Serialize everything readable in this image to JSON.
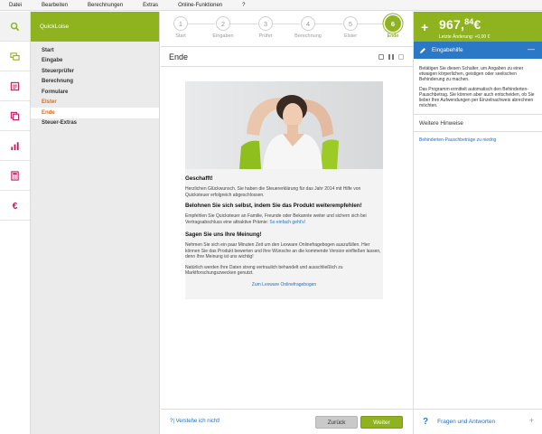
{
  "menu": [
    "Datei",
    "Bearbeiten",
    "Berechnungen",
    "Extras",
    "Online-Funktionen",
    "?"
  ],
  "sidebar_icons": [
    "search-icon",
    "chat-icon",
    "form-icon",
    "copy-icon",
    "bar-chart-icon",
    "calculator-icon",
    "euro-icon"
  ],
  "nav": {
    "title": "QuickLoise",
    "items": [
      {
        "label": "Start",
        "state": "normal"
      },
      {
        "label": "Eingabe",
        "state": "normal"
      },
      {
        "label": "Steuerprüfer",
        "state": "normal"
      },
      {
        "label": "Berechnung",
        "state": "normal"
      },
      {
        "label": "Formulare",
        "state": "normal"
      },
      {
        "label": "Elster",
        "state": "visited"
      },
      {
        "label": "Ende",
        "state": "active"
      },
      {
        "label": "Steuer-Extras",
        "state": "normal"
      }
    ]
  },
  "steps": [
    {
      "num": "1",
      "label": "Start"
    },
    {
      "num": "2",
      "label": "Eingaben"
    },
    {
      "num": "3",
      "label": "Prüfer"
    },
    {
      "num": "4",
      "label": "Berechnung"
    },
    {
      "num": "5",
      "label": "Elster"
    },
    {
      "num": "6",
      "label": "Ende"
    }
  ],
  "page_title": "Ende",
  "content": {
    "h1": "Geschafft!",
    "p1": "Herzlichen Glückwunsch. Sie haben die Steuererklärung für das Jahr 2014 mit Hilfe von Quicksteuer erfolgreich abgeschlossen.",
    "h2": "Belohnen Sie sich selbst, indem Sie das Produkt weiterempfehlen!",
    "p2": "Empfehlen Sie Quicksteuer an Familie, Freunde oder Bekannte weiter und sichern sich bei Vertragsabschluss eine attraktive Prämie:",
    "p2_link": "So einfach geht's!",
    "h3": "Sagen Sie uns Ihre Meinung!",
    "p3": "Nehmen Sie sich ein paar Minuten Zeit um den Lexware Onlinefragebogen auszufüllen. Hier können Sie das Produkt bewerten und Ihre Wünsche an die kommende Version einfließen lassen, denn Ihre Meinung ist uns wichtig!",
    "p4": "Natürlich werden Ihre Daten streng vertraulich behandelt und ausschließlich zu Marktforschungszwecken genutzt.",
    "survey_link": "Zum Lexware Onlinefragebogen"
  },
  "footer": {
    "help_link": "?| Verstehe ich nicht!",
    "back": "Zurück",
    "next": "Weiter"
  },
  "refund": {
    "plus": "+",
    "amount_main": "967,",
    "amount_cents": "84",
    "currency": "€",
    "change": "Letzte Änderung: +0,00 €"
  },
  "help": {
    "title": "Eingabehilfe",
    "collapse": "—",
    "p1": "Betätigen Sie diesen Schalter, um Angaben zu einer etwaigen körperlichen, geistigen oder seelischen Behinderung zu machen.",
    "p2": "Das Programm ermittelt automatisch den Behinderten-Pauschbetrag. Sie können aber auch entscheiden, ob Sie lieber Ihre Aufwendungen per Einzelnachweis abrechnen möchten."
  },
  "more_hints": {
    "title": "Weitere Hinweise",
    "link": "Behinderten-Pauschbeträge zu niedrig"
  },
  "qa": {
    "icon": "?",
    "label": "Fragen und Antworten",
    "plus": "+"
  },
  "colors": {
    "green": "#8fb21f",
    "blue": "#2a78c6",
    "orange": "#e06a10"
  }
}
